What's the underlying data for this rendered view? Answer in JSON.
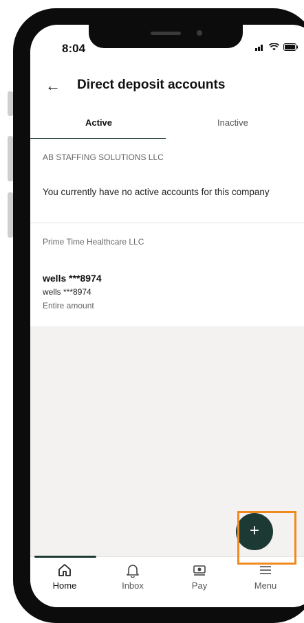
{
  "status_bar": {
    "time": "8:04"
  },
  "header": {
    "title": "Direct deposit accounts"
  },
  "tabs": [
    {
      "label": "Active"
    },
    {
      "label": "Inactive"
    }
  ],
  "companies": [
    {
      "name": "AB STAFFING SOLUTIONS LLC",
      "message": "You currently have no active accounts for this company"
    },
    {
      "name": "Prime Time Healthcare LLC",
      "account": {
        "name": "wells ***8974",
        "sub": "wells ***8974",
        "amount": "Entire amount"
      }
    }
  ],
  "fab": {
    "icon": "plus-icon",
    "label": "+"
  },
  "bottom_nav": [
    {
      "label": "Home",
      "icon": "home-icon"
    },
    {
      "label": "Inbox",
      "icon": "bell-icon"
    },
    {
      "label": "Pay",
      "icon": "pay-icon"
    },
    {
      "label": "Menu",
      "icon": "menu-icon"
    }
  ],
  "colors": {
    "accent": "#1c3a33",
    "highlight": "#f08a1c"
  }
}
